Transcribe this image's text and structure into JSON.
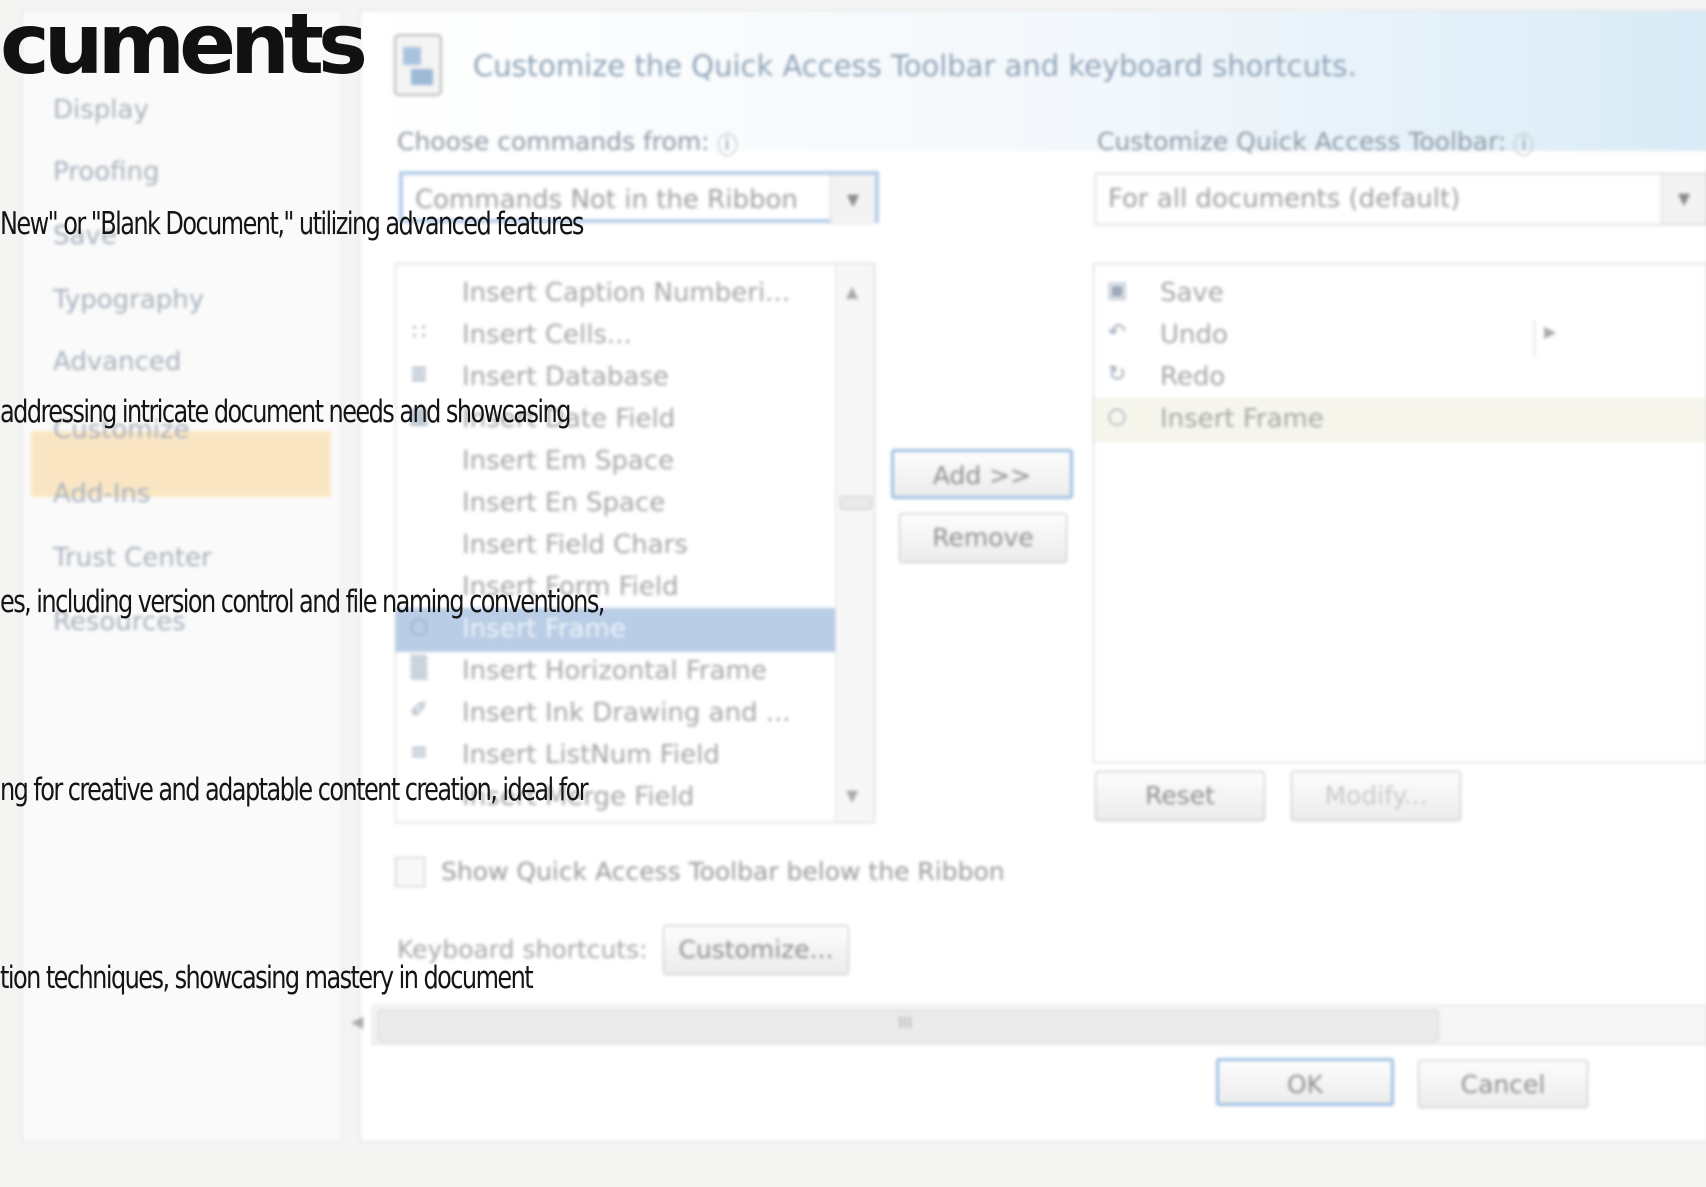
{
  "nav": {
    "items": [
      "Display",
      "Proofing",
      "Save",
      "Typography",
      "Advanced",
      "Customize",
      "Add-Ins",
      "Trust Center",
      "Resources"
    ]
  },
  "header": {
    "title": "Customize the Quick Access Toolbar and keyboard shortcuts."
  },
  "left": {
    "label": "Choose commands from:",
    "combo_value": "Commands Not in the Ribbon",
    "items": [
      {
        "label": "Insert Caption Numberi...",
        "icon": "caption-icon"
      },
      {
        "label": "Insert Cells...",
        "icon": "cells-icon"
      },
      {
        "label": "Insert Database",
        "icon": "database-icon"
      },
      {
        "label": "Insert Date Field",
        "icon": "date-icon"
      },
      {
        "label": "Insert Em Space",
        "icon": ""
      },
      {
        "label": "Insert En Space",
        "icon": ""
      },
      {
        "label": "Insert Field Chars",
        "icon": ""
      },
      {
        "label": "Insert Form Field",
        "icon": ""
      },
      {
        "label": "Insert Frame",
        "icon": "frame-icon"
      },
      {
        "label": "Insert Horizontal Frame",
        "icon": "horizontal-frame-icon"
      },
      {
        "label": "Insert Ink Drawing and ...",
        "icon": "ink-icon"
      },
      {
        "label": "Insert ListNum Field",
        "icon": "listnum-icon"
      },
      {
        "label": "Insert Merge Field",
        "icon": ""
      }
    ],
    "selected_index": 8
  },
  "middle": {
    "add": "Add >>",
    "remove": "Remove"
  },
  "right": {
    "label": "Customize Quick Access Toolbar:",
    "combo_value": "For all documents (default)",
    "items": [
      {
        "label": "Save",
        "icon": "save-icon"
      },
      {
        "label": "Undo",
        "icon": "undo-icon"
      },
      {
        "label": "Redo",
        "icon": "redo-icon"
      },
      {
        "label": "Insert Frame",
        "icon": "frame-icon"
      }
    ],
    "reset": "Reset",
    "modify": "Modify..."
  },
  "show_below_label": "Show Quick Access Toolbar below the Ribbon",
  "keyboard": {
    "label": "Keyboard shortcuts:",
    "button": "Customize..."
  },
  "footer": {
    "ok": "OK",
    "cancel": "Cancel"
  },
  "scrollbar_label": "III",
  "overlay": {
    "title": "cuments",
    "lines": [
      "New\" or \"Blank Document,\" utilizing advanced features",
      "addressing intricate document needs and showcasing",
      "es, including version control and file naming conventions,",
      "ng for creative and adaptable content creation, ideal for",
      "tion techniques, showcasing mastery in document"
    ]
  }
}
